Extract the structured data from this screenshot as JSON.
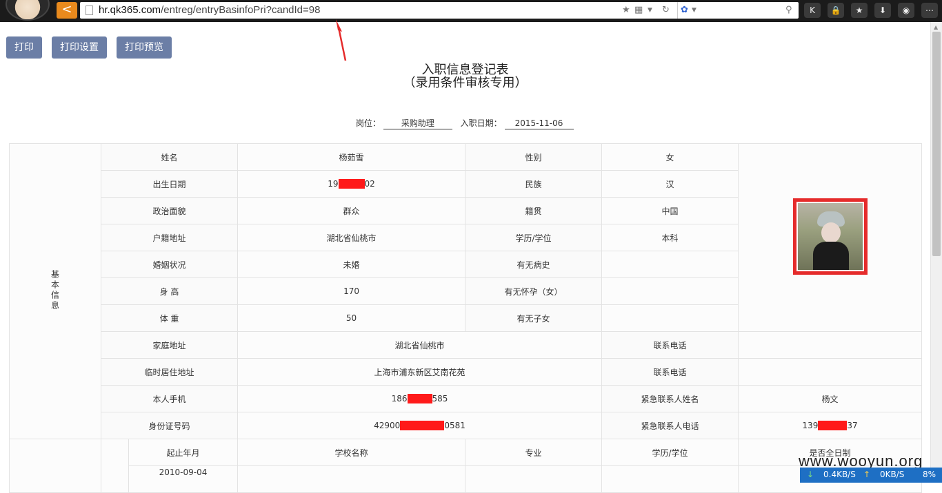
{
  "browser": {
    "url_host": "hr.qk365.com",
    "url_path": "/entreg/entryBasinfoPri?candId=98",
    "back_label": "<"
  },
  "toolbar": {
    "print": "打印",
    "print_settings": "打印设置",
    "print_preview": "打印预览"
  },
  "form": {
    "title": "入职信息登记表",
    "subtitle": "（录用条件审核专用）",
    "position_label": "岗位：",
    "position_value": "采购助理",
    "date_label": "入职日期：",
    "date_value": "2015-11-06"
  },
  "section_basic": "基本信息",
  "rows": {
    "name_label": "姓名",
    "name_value": "杨茹雪",
    "gender_label": "性别",
    "gender_value": "女",
    "birth_label": "出生日期",
    "birth_prefix": "19",
    "birth_suffix": "02",
    "ethnic_label": "民族",
    "ethnic_value": "汉",
    "political_label": "政治面貌",
    "political_value": "群众",
    "native_label": "籍贯",
    "native_value": "中国",
    "hukou_label": "户籍地址",
    "hukou_value": "湖北省仙桃市",
    "edu_label": "学历/学位",
    "edu_value": "本科",
    "marital_label": "婚姻状况",
    "marital_value": "未婚",
    "disease_label": "有无病史",
    "disease_value": "",
    "height_label": "身 高",
    "height_value": "170",
    "pregnant_label": "有无怀孕（女）",
    "pregnant_value": "",
    "weight_label": "体 重",
    "weight_value": "50",
    "children_label": "有无子女",
    "children_value": "",
    "home_label": "家庭地址",
    "home_value": "湖北省仙桃市",
    "phone1_label": "联系电话",
    "phone1_value": "",
    "temp_label": "临时居住地址",
    "temp_value": "上海市浦东新区艾南花苑",
    "phone2_label": "联系电话",
    "phone2_value": "",
    "mobile_label": "本人手机",
    "mobile_prefix": "186",
    "mobile_suffix": "585",
    "emergency_name_label": "紧急联系人姓名",
    "emergency_name_value": "杨文",
    "id_label": "身份证号码",
    "id_prefix": "42900",
    "id_suffix": "0581",
    "emergency_phone_label": "紧急联系人电话",
    "emergency_phone_prefix": "139",
    "emergency_phone_suffix": "37"
  },
  "education": {
    "headers": [
      "起止年月",
      "学校名称",
      "专业",
      "学历/学位",
      "是否全日制"
    ],
    "first_start": "2010-09-04"
  },
  "watermark": "www.wooyun.org",
  "speed": {
    "down": "0.4KB/S",
    "up": "0KB/S",
    "pct": "8%"
  },
  "colors": {
    "button": "#6b7ea6",
    "redaction": "#ff1a1a",
    "highlight": "#e52b2b",
    "back_button": "#e98a1d"
  }
}
